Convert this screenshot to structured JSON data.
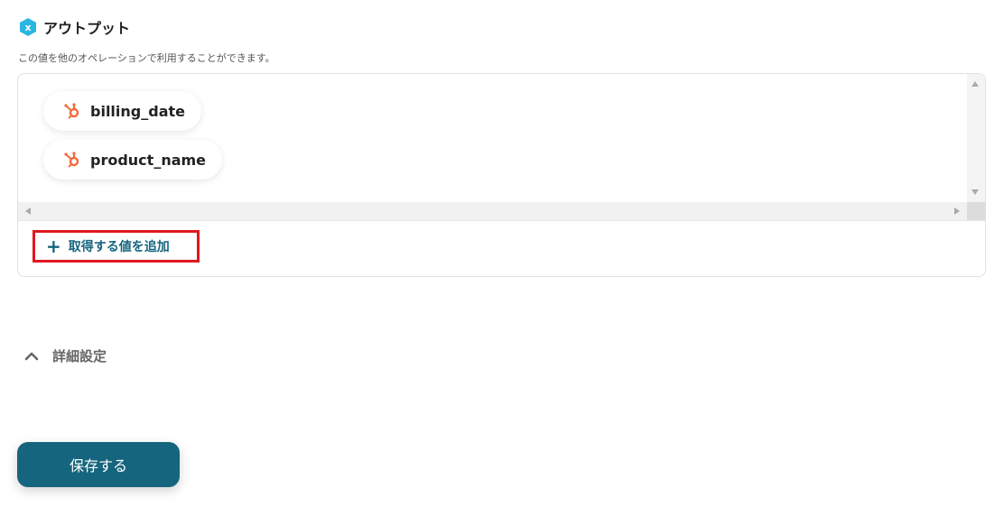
{
  "output": {
    "title": "アウトプット",
    "description": "この値を他のオペレーションで利用することができます。",
    "items": [
      {
        "label": "billing_date",
        "icon": "hubspot-icon"
      },
      {
        "label": "product_name",
        "icon": "hubspot-icon"
      }
    ],
    "add_value_label": "取得する値を追加"
  },
  "advanced": {
    "label": "詳細設定"
  },
  "footer": {
    "save_label": "保存する"
  },
  "colors": {
    "accent": "#16657e",
    "hubspot": "#f26a3d",
    "highlight": "#e0181f",
    "header_icon": "#29b6e3"
  }
}
